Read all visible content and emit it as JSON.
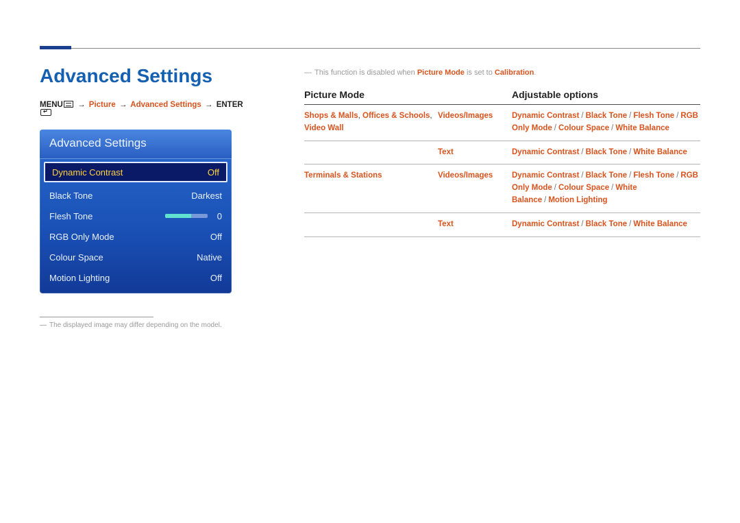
{
  "page": {
    "title": "Advanced Settings"
  },
  "breadcrumb": {
    "menu": "MENU",
    "p1": "Picture",
    "p2": "Advanced Settings",
    "enter": "ENTER"
  },
  "osd": {
    "title": "Advanced Settings",
    "rows": {
      "dynamic_contrast": {
        "label": "Dynamic Contrast",
        "value": "Off"
      },
      "black_tone": {
        "label": "Black Tone",
        "value": "Darkest"
      },
      "flesh_tone": {
        "label": "Flesh Tone",
        "value": "0"
      },
      "rgb_only": {
        "label": "RGB Only Mode",
        "value": "Off"
      },
      "colour_space": {
        "label": "Colour Space",
        "value": "Native"
      },
      "motion_lighting": {
        "label": "Motion Lighting",
        "value": "Off"
      }
    }
  },
  "footnote": "The displayed image may differ depending on the model.",
  "note": {
    "pre": "This function is disabled when ",
    "hl1": "Picture Mode",
    "mid": " is set to ",
    "hl2": "Calibration",
    "post": "."
  },
  "table": {
    "head": {
      "c1": "Picture Mode",
      "c3": "Adjustable options"
    },
    "r0": {
      "mode_a": "Shops & Malls",
      "mode_b": "Offices & Schools",
      "mode_c": "Video Wall",
      "sub": "Videos/Images",
      "o1": "Dynamic Contrast",
      "o2": "Black Tone",
      "o3": "Flesh Tone",
      "o4": "RGB Only Mode",
      "o5": "Colour Space",
      "o6": "White Balance"
    },
    "r1": {
      "sub": "Text",
      "o1": "Dynamic Contrast",
      "o2": "Black Tone",
      "o3": "White Balance"
    },
    "r2": {
      "mode": "Terminals & Stations",
      "sub": "Videos/Images",
      "o1": "Dynamic Contrast",
      "o2": "Black Tone",
      "o3": "Flesh Tone",
      "o4": "RGB Only Mode",
      "o5": "Colour Space",
      "o6": "White Balance",
      "o7": "Motion Lighting"
    },
    "r3": {
      "sub": "Text",
      "o1": "Dynamic Contrast",
      "o2": "Black Tone",
      "o3": "White Balance"
    }
  }
}
